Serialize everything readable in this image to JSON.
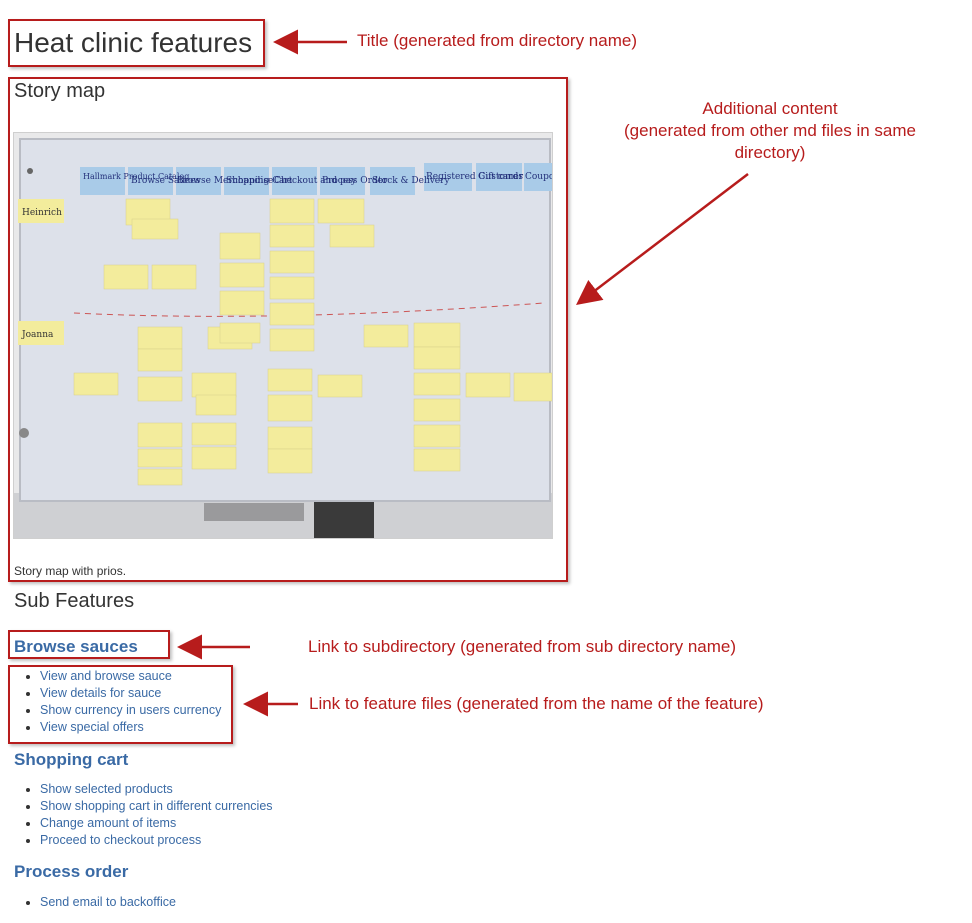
{
  "page": {
    "title": "Heat clinic features",
    "story_heading": "Story map",
    "image_caption": "Story map with prios.",
    "sub_features_heading": "Sub Features"
  },
  "whiteboard": {
    "header_cards": [
      "Hallmark Product Catalog",
      "Browse Sauces",
      "Browse Merchandise",
      "Shopping Cart",
      "Checkout and pay",
      "Process Order",
      "Stock & Delivery",
      "Registered Customer",
      "Gift cards",
      "Coupons"
    ],
    "personas": [
      "Heinrich",
      "Joanna"
    ]
  },
  "groups": [
    {
      "title": "Browse sauces",
      "features": [
        "View and browse sauce",
        "View details for sauce",
        "Show currency in users currency",
        "View special offers"
      ]
    },
    {
      "title": "Shopping cart",
      "features": [
        "Show selected products",
        "Show shopping cart in different currencies",
        "Change amount of items",
        "Proceed to checkout process"
      ]
    },
    {
      "title": "Process order",
      "features": [
        "Send email to backoffice"
      ]
    }
  ],
  "annotations": {
    "title_note": "Title (generated from directory name)",
    "content_note_line1": "Additional content",
    "content_note_line2": "(generated from other md files in same",
    "content_note_line3": "directory)",
    "subdir_note": "Link to subdirectory (generated from sub directory name)",
    "feature_note": "Link to feature files (generated from the name of the feature)"
  },
  "colors": {
    "annotation_red": "#b71c1c",
    "link_blue": "#3a6aa5",
    "board": "#dde1ea",
    "sticky": "#f3ec9c",
    "header_card": "#a9cbe8"
  }
}
